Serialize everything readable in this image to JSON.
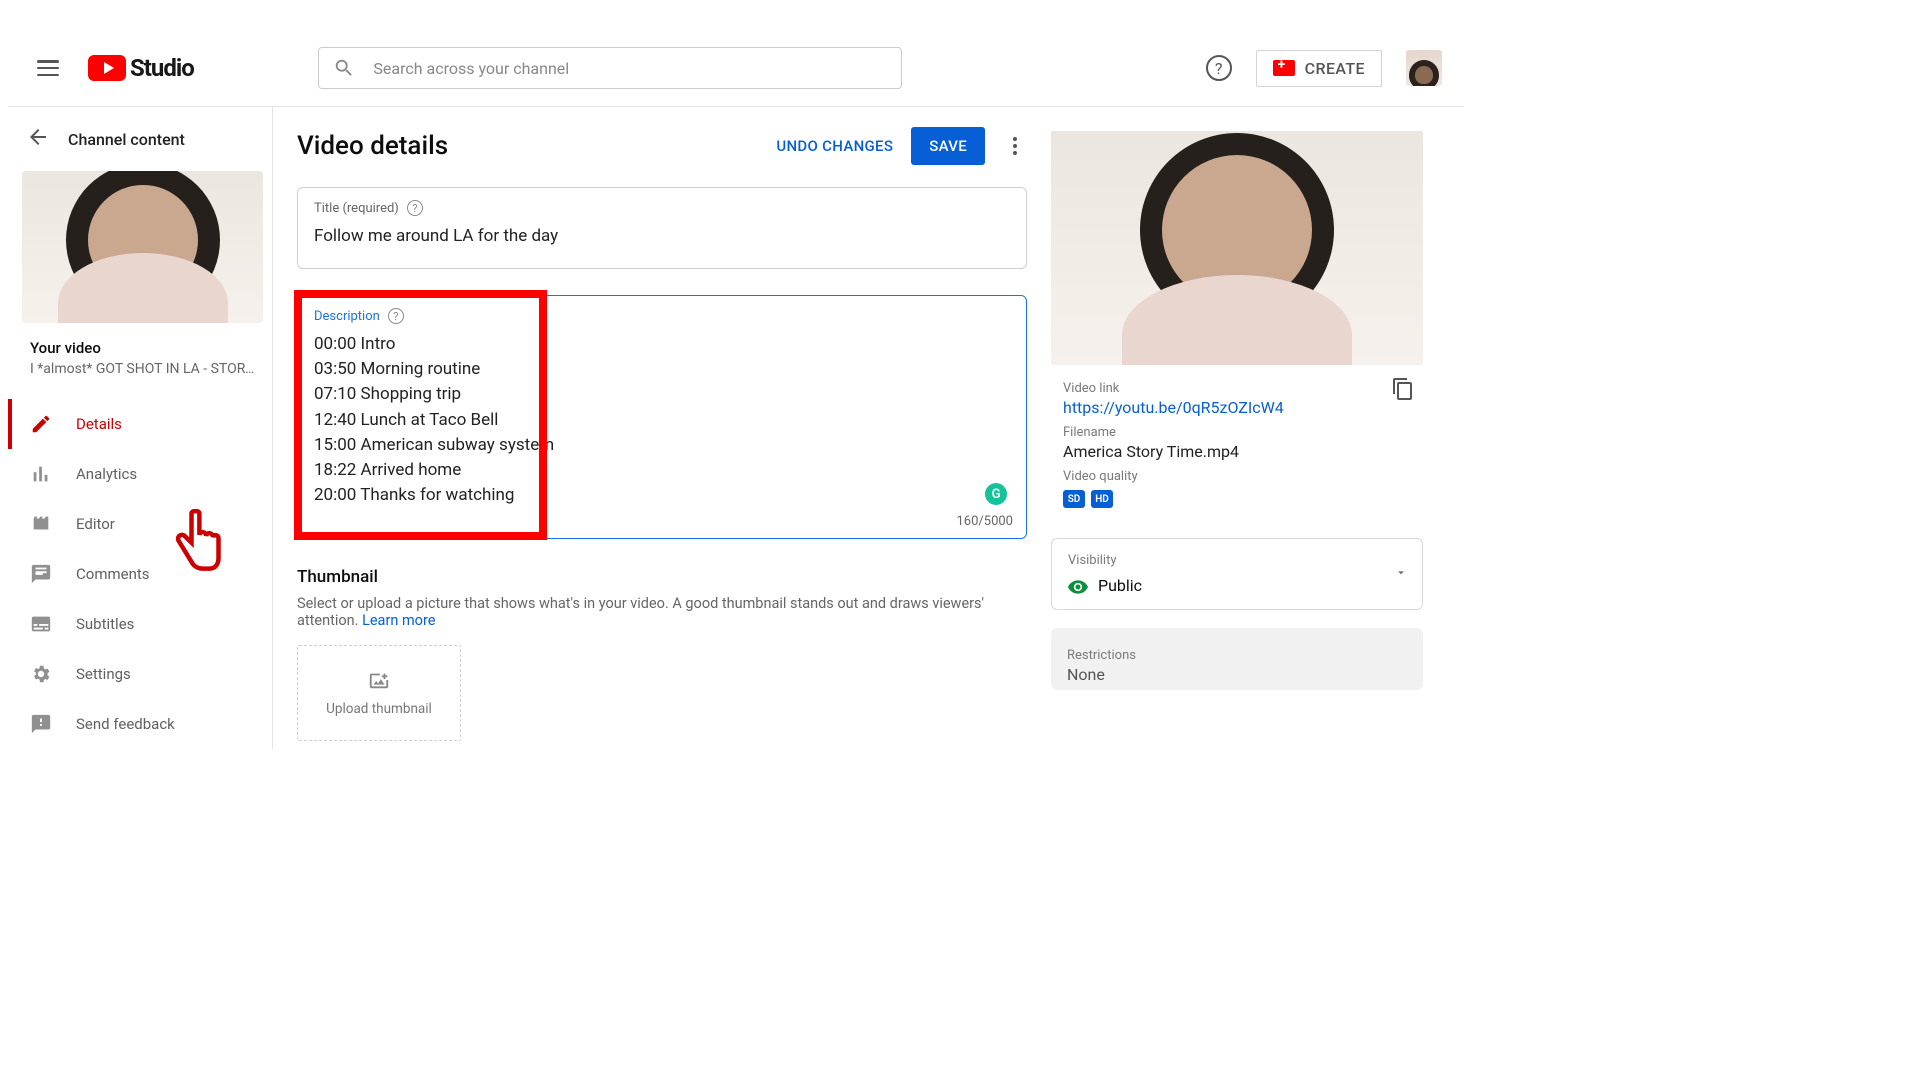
{
  "header": {
    "logo_text": "Studio",
    "search_placeholder": "Search across your channel",
    "create_label": "CREATE"
  },
  "sidebar": {
    "back_label": "Channel content",
    "your_video_label": "Your video",
    "video_name": "I *almost* GOT SHOT IN LA - STORY ...",
    "items": [
      {
        "label": "Details"
      },
      {
        "label": "Analytics"
      },
      {
        "label": "Editor"
      },
      {
        "label": "Comments"
      },
      {
        "label": "Subtitles"
      }
    ],
    "footer": {
      "settings": "Settings",
      "feedback": "Send feedback"
    }
  },
  "page": {
    "title": "Video details",
    "undo": "UNDO CHANGES",
    "save": "SAVE",
    "title_field": {
      "label": "Title (required)",
      "value": "Follow me around LA for the day"
    },
    "desc_field": {
      "label": "Description",
      "value": "00:00 Intro\n03:50 Morning routine\n07:10 Shopping trip\n12:40 Lunch at Taco Bell\n15:00 American subway system\n18:22 Arrived home\n20:00 Thanks for watching",
      "counter": "160/5000"
    },
    "thumb": {
      "title": "Thumbnail",
      "help": "Select or upload a picture that shows what's in your video. A good thumbnail stands out and draws viewers' attention.",
      "learn": "Learn more",
      "upload": "Upload thumbnail"
    }
  },
  "right": {
    "link_label": "Video link",
    "link": "https://youtu.be/0qR5zOZIcW4",
    "filename_label": "Filename",
    "filename": "America Story Time.mp4",
    "quality_label": "Video quality",
    "badges": [
      "SD",
      "HD"
    ],
    "visibility_label": "Visibility",
    "visibility_value": "Public",
    "restrictions_label": "Restrictions",
    "restrictions_value": "None"
  }
}
